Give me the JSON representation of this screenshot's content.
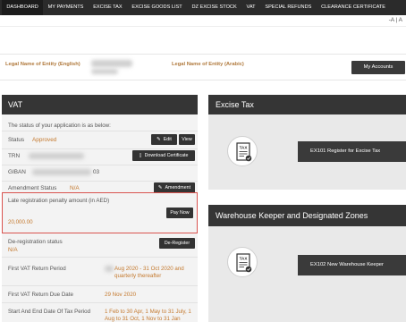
{
  "nav": {
    "items": [
      {
        "label": "DASHBOARD",
        "active": true
      },
      {
        "label": "MY PAYMENTS"
      },
      {
        "label": "EXCISE TAX"
      },
      {
        "label": "EXCISE GOODS LIST"
      },
      {
        "label": "DZ EXCISE STOCK"
      },
      {
        "label": "VAT"
      },
      {
        "label": "SPECIAL REFUNDS"
      },
      {
        "label": "CLEARANCE CERTIFICATE"
      }
    ]
  },
  "accessibility": {
    "text": "-A | A"
  },
  "entity": {
    "english_label": "Legal Name of Entity (English)",
    "arabic_label": "Legal Name of Entity (Arabic)",
    "my_accounts_label": "My Accounts"
  },
  "vat": {
    "title": "VAT",
    "status_intro": "The status of your application is as below:",
    "status_label": "Status",
    "status_value": "Approved",
    "edit_label": "Edit",
    "view_label": "View",
    "trn_label": "TRN",
    "download_certificate_label": "Download Certificate",
    "giban_label": "GIBAN",
    "giban_suffix": "03",
    "amendment_status_label": "Amendment Status",
    "amendment_status_value": "N/A",
    "amendment_button_label": "Amendment",
    "penalty_label": "Late registration penalty amount (in AED)",
    "penalty_amount": "20,000.00",
    "pay_now_label": "Pay Now",
    "dereg_status_label": "De-registration status",
    "dereg_status_value": "N/A",
    "dereg_button_label": "De-Register",
    "first_return_period_label": "First VAT Return Period",
    "first_return_period_value": "Aug 2020 - 31 Oct 2020 and quarterly thereafter",
    "first_return_due_label": "First VAT Return Due Date",
    "first_return_due_value": "29 Nov 2020",
    "tax_period_label": "Start And End Date Of Tax Period",
    "tax_period_value": "1 Feb to 30 Apr, 1 May to 31 July, 1 Aug to 31 Oct, 1 Nov to 31 Jan"
  },
  "excise": {
    "title": "Excise Tax",
    "icon_text": "TAX",
    "button_label": "EX101 Register for Excise Tax"
  },
  "warehouse": {
    "title": "Warehouse Keeper and Designated Zones",
    "icon_text": "TAX",
    "button_label": "EX102 New Warehouse Keeper"
  }
}
